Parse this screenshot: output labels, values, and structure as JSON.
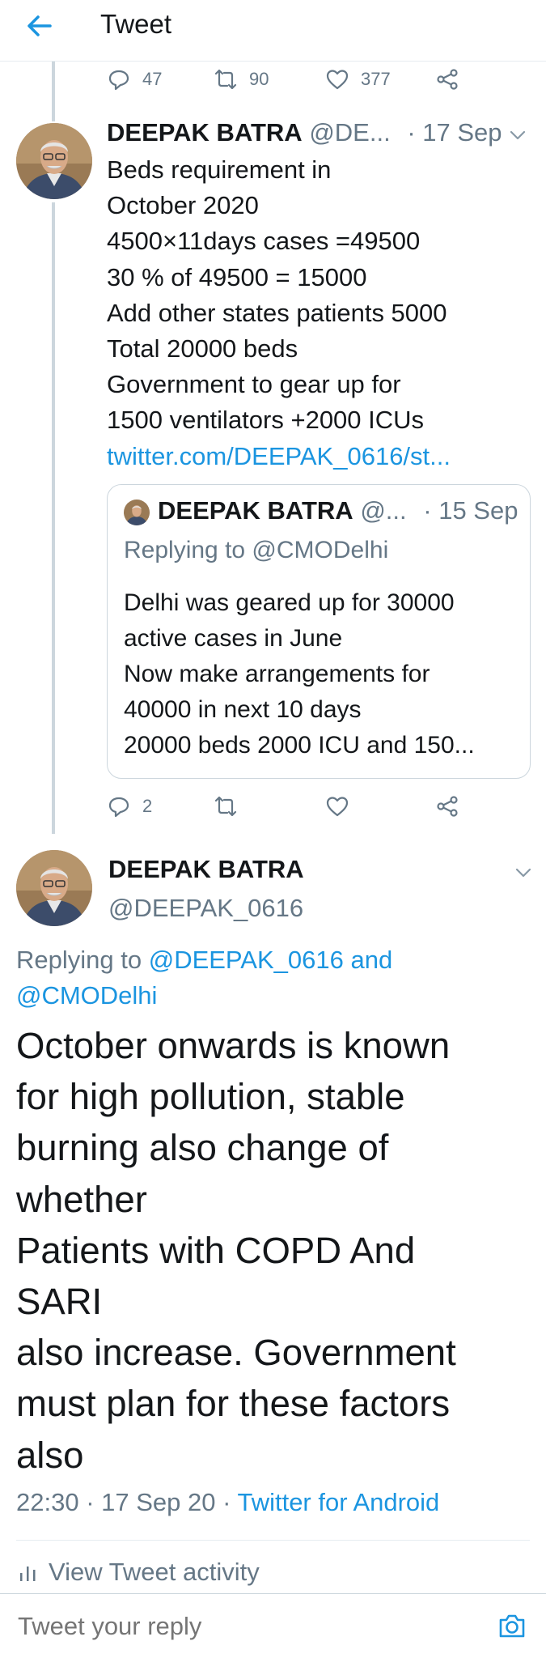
{
  "header": {
    "title": "Tweet",
    "back_icon": "arrow-left-icon"
  },
  "top_actions": {
    "reply_count": "47",
    "retweet_count": "90",
    "like_count": "377"
  },
  "tweet1": {
    "author_name": "DEEPAK BATRA",
    "author_handle": "@DE...",
    "date": "· 17 Sep",
    "lines": [
      "Beds requirement in",
      "October 2020",
      "4500×11days cases =49500",
      "30 % of 49500 = 15000",
      "Add other states patients 5000",
      "Total 20000 beds",
      "Government to gear up for",
      "1500 ventilators +2000 ICUs"
    ],
    "link": "twitter.com/DEEPAK_0616/st...",
    "quote": {
      "author_name": "DEEPAK BATRA",
      "author_handle": "@...",
      "date": "· 15 Sep",
      "replying_to": "Replying to @CMODelhi",
      "lines": [
        "Delhi was geared up for 30000",
        "active cases in June",
        "Now make arrangements for",
        "40000 in next 10 days",
        "20000 beds 2000 ICU and 150..."
      ]
    },
    "actions": {
      "reply_count": "2"
    }
  },
  "focus_tweet": {
    "author_name": "DEEPAK BATRA",
    "author_handle": "@DEEPAK_0616",
    "replying_prefix": "Replying to ",
    "replying_line1": "@DEEPAK_0616 and",
    "replying_line2": "@CMODelhi",
    "lines": [
      "October onwards is known",
      "for high pollution, stable",
      "burning also change of",
      "whether",
      "Patients with COPD And",
      "SARI",
      "also increase. Government",
      "must plan for these factors",
      "also"
    ],
    "timestamp": "22:30 · 17 Sep 20 · ",
    "source": "Twitter for Android",
    "activity_label": "View Tweet activity"
  },
  "reply_bar": {
    "placeholder": "Tweet your reply",
    "camera_icon": "camera-icon"
  },
  "colors": {
    "accent": "#1b95e0",
    "secondary_text": "#657786",
    "border": "#e6ecf0"
  }
}
